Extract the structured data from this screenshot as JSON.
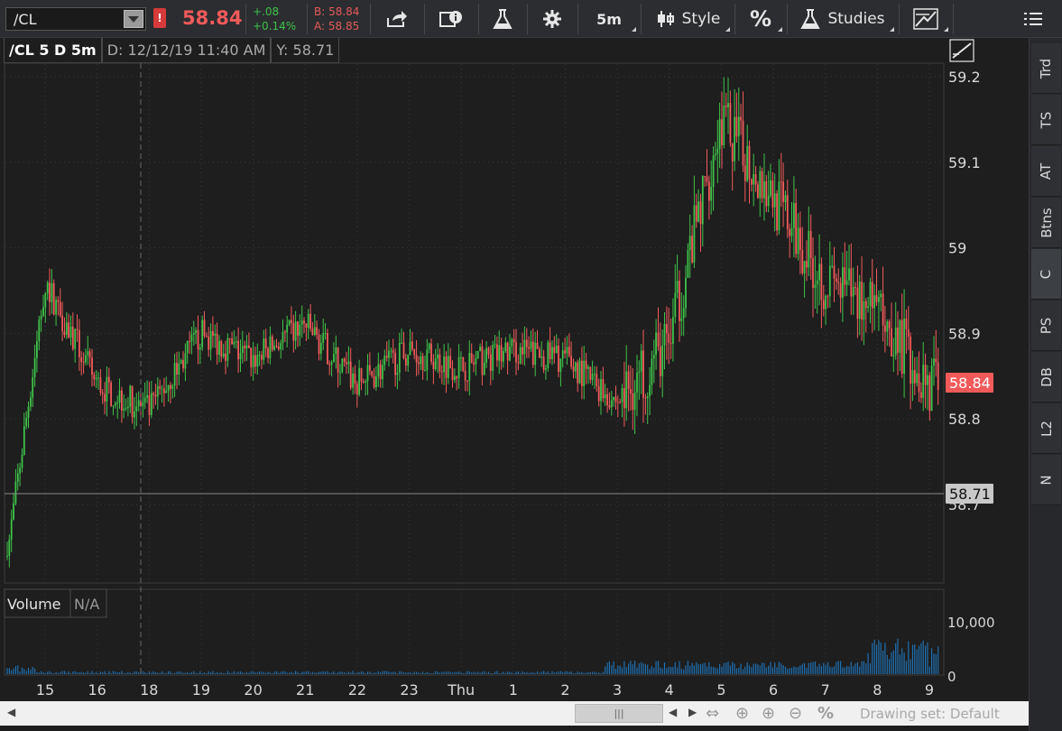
{
  "toolbar": {
    "symbol": "/CL",
    "alert_badge": "!",
    "last_price": "58.84",
    "change_abs": "+.08",
    "change_pct": "+0.14%",
    "bid": "B: 58.84",
    "ask": "A: 58.85",
    "timeframe": "5m",
    "style_label": "Style",
    "percent_label": "%",
    "studies_label": "Studies"
  },
  "chart_header": {
    "title": "/CL 5 D 5m",
    "date": "D: 12/12/19 11:40 AM",
    "y_value": "Y: 58.71"
  },
  "volume_header": {
    "label": "Volume",
    "value": "N/A"
  },
  "right_tabs": [
    "Trd",
    "TS",
    "AT",
    "Btns",
    "C",
    "PS",
    "DB",
    "L2",
    "N"
  ],
  "price_axis": {
    "current_label": "58.84",
    "crosshair_label": "58.71",
    "volume_top_label": "10,000",
    "volume_zero_label": "0"
  },
  "bottom_bar": {
    "scroll_thumb": "|||",
    "drawing_set": "Drawing set: Default"
  },
  "colors": {
    "up": "#3fc24a",
    "down": "#f25a5a",
    "background": "#1e1e1e",
    "volume": "#1e6fb0"
  },
  "chart_data": {
    "type": "candlestick",
    "title": "/CL 5 D 5m",
    "x_ticks": [
      "15",
      "16",
      "18",
      "19",
      "20",
      "21",
      "22",
      "23",
      "Thu",
      "1",
      "2",
      "3",
      "4",
      "5",
      "6",
      "7",
      "8",
      "9"
    ],
    "y_ticks": [
      59.2,
      59.1,
      59.0,
      58.9,
      58.8,
      58.7
    ],
    "ylim": [
      58.63,
      59.21
    ],
    "last_price": 58.84,
    "crosshair_y": 58.71,
    "volume_ylim": [
      0,
      10000
    ],
    "key_points": [
      {
        "x": "open",
        "price": 58.64
      },
      {
        "x": "15",
        "price": 58.96
      },
      {
        "x": "16",
        "price": 58.84
      },
      {
        "x": "18",
        "price": 58.81
      },
      {
        "x": "19",
        "price": 58.9
      },
      {
        "x": "20",
        "price": 58.87
      },
      {
        "x": "21",
        "price": 58.91
      },
      {
        "x": "22",
        "price": 58.84
      },
      {
        "x": "23",
        "price": 58.88
      },
      {
        "x": "Thu",
        "price": 58.86
      },
      {
        "x": "1",
        "price": 58.88
      },
      {
        "x": "2",
        "price": 58.87
      },
      {
        "x": "3",
        "price": 58.82
      },
      {
        "x": "4",
        "price": 58.89
      },
      {
        "x": "5",
        "price": 59.15
      },
      {
        "x": "6",
        "price": 59.06
      },
      {
        "x": "7",
        "price": 58.96
      },
      {
        "x": "8",
        "price": 58.93
      },
      {
        "x": "9",
        "price": 58.84
      }
    ]
  }
}
